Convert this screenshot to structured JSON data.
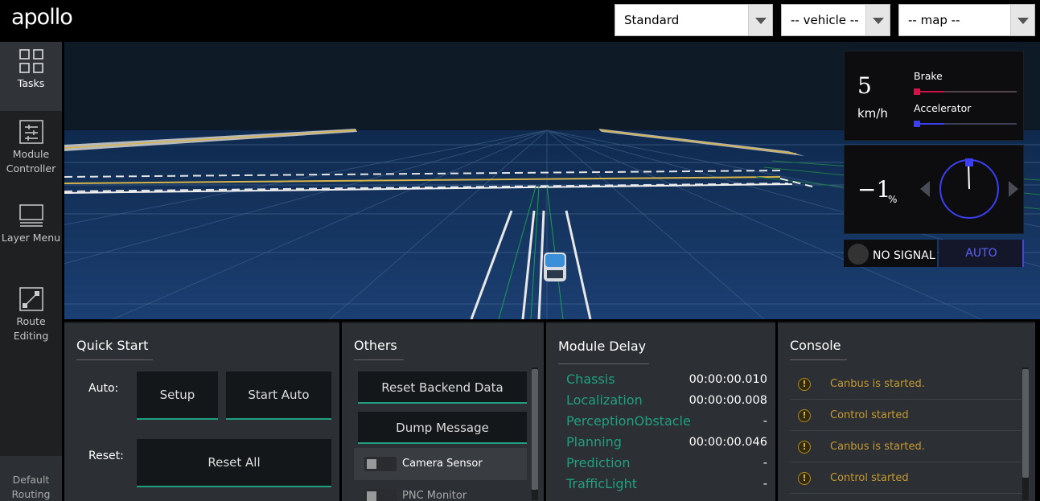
{
  "header": {
    "logo": "apollo",
    "mode_select": "Standard",
    "vehicle_select": "-- vehicle --",
    "map_select": "-- map --"
  },
  "sidebar": {
    "items": [
      {
        "label": "Tasks",
        "icon": "grid-icon"
      },
      {
        "label": "Module Controller",
        "icon": "sliders-icon"
      },
      {
        "label": "Layer Menu",
        "icon": "layers-icon"
      },
      {
        "label": "Route Editing",
        "icon": "route-icon"
      }
    ],
    "default_routing": "Default Routing"
  },
  "dashboard": {
    "speed": "5",
    "speed_unit": "km/h",
    "brake_label": "Brake",
    "brake_level": 0.03,
    "accelerator_label": "Accelerator",
    "accelerator_level": 0.03,
    "steering": "−1",
    "steering_unit": "%",
    "signal": "NO SIGNAL",
    "drive_mode": "AUTO",
    "colors": {
      "brake": "#d0144a",
      "accelerator": "#3a3ff0",
      "wheel": "#3a3ff0",
      "accent": "#20a080"
    }
  },
  "quick_start": {
    "title": "Quick Start",
    "auto_label": "Auto:",
    "setup_button": "Setup",
    "start_auto_button": "Start Auto",
    "reset_label": "Reset:",
    "reset_all_button": "Reset All"
  },
  "others": {
    "title": "Others",
    "reset_backend_button": "Reset Backend Data",
    "dump_message_button": "Dump Message",
    "toggles": [
      "Camera Sensor",
      "PNC Monitor"
    ]
  },
  "module_delay": {
    "title": "Module Delay",
    "rows": [
      {
        "name": "Chassis",
        "value": "00:00:00.010"
      },
      {
        "name": "Localization",
        "value": "00:00:00.008"
      },
      {
        "name": "PerceptionObstacle",
        "value": "-"
      },
      {
        "name": "Planning",
        "value": "00:00:00.046"
      },
      {
        "name": "Prediction",
        "value": "-"
      },
      {
        "name": "TrafficLight",
        "value": "-"
      }
    ]
  },
  "console": {
    "title": "Console",
    "messages": [
      "Canbus is started.",
      "Control started",
      "Canbus is started.",
      "Control started"
    ]
  }
}
